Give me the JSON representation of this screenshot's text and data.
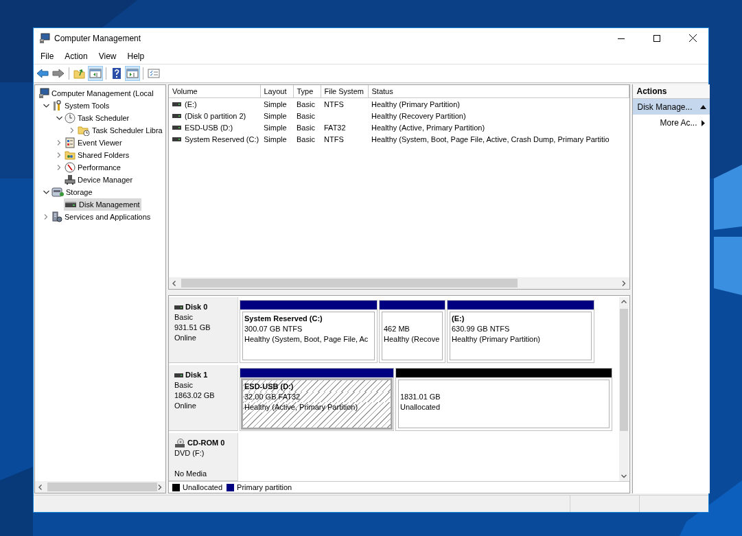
{
  "window": {
    "title": "Computer Management"
  },
  "menu": [
    "File",
    "Action",
    "View",
    "Help"
  ],
  "toolbar": [
    {
      "kind": "back",
      "pressed": false
    },
    {
      "kind": "forward",
      "pressed": false
    },
    {
      "kind": "separator"
    },
    {
      "kind": "up",
      "pressed": false
    },
    {
      "kind": "tree-pane",
      "pressed": true
    },
    {
      "kind": "separator"
    },
    {
      "kind": "help",
      "pressed": false
    },
    {
      "kind": "action-pane",
      "pressed": true
    },
    {
      "kind": "separator"
    },
    {
      "kind": "properties",
      "pressed": false
    }
  ],
  "tree": [
    {
      "label": "Computer Management (Local",
      "selected": false,
      "children": [
        {
          "label": "System Tools",
          "expanded": true,
          "selected": false,
          "children": [
            {
              "label": "Task Scheduler",
              "expanded": true,
              "selected": false,
              "children": [
                {
                  "label": "Task Scheduler Libra",
                  "expanded": false,
                  "selected": false
                }
              ]
            },
            {
              "label": "Event Viewer",
              "expanded": false,
              "selected": false
            },
            {
              "label": "Shared Folders",
              "expanded": false,
              "selected": false
            },
            {
              "label": "Performance",
              "expanded": false,
              "selected": false
            },
            {
              "label": "Device Manager",
              "selected": false
            }
          ]
        },
        {
          "label": "Storage",
          "expanded": true,
          "selected": false,
          "children": [
            {
              "label": "Disk Management",
              "selected": true
            }
          ]
        },
        {
          "label": "Services and Applications",
          "expanded": false,
          "selected": false
        }
      ]
    }
  ],
  "volumes": {
    "columns": [
      "Volume",
      "Layout",
      "Type",
      "File System",
      "Status"
    ],
    "rows": [
      [
        "(E:)",
        "Simple",
        "Basic",
        "NTFS",
        "Healthy (Primary Partition)"
      ],
      [
        "(Disk 0 partition 2)",
        "Simple",
        "Basic",
        "",
        "Healthy (Recovery Partition)"
      ],
      [
        "ESD-USB (D:)",
        "Simple",
        "Basic",
        "FAT32",
        "Healthy (Active, Primary Partition)"
      ],
      [
        "System Reserved (C:)",
        "Simple",
        "Basic",
        "NTFS",
        "Healthy (System, Boot, Page File, Active, Crash Dump, Primary Partitio"
      ]
    ]
  },
  "disks": [
    {
      "name": "Disk 0",
      "kind": "disk",
      "type": "Basic",
      "size": "931.51 GB",
      "status": "Online",
      "partitions": [
        {
          "kind": "primary",
          "selected": false,
          "name": "System Reserved  (C:)",
          "size": "300.07 GB NTFS",
          "status": "Healthy (System, Boot, Page File, Ac"
        },
        {
          "kind": "primary",
          "selected": false,
          "size": "462 MB",
          "status": "Healthy (Recove"
        },
        {
          "kind": "primary",
          "selected": false,
          "name": "(E:)",
          "size": "630.99 GB NTFS",
          "status": "Healthy (Primary Partition)"
        }
      ]
    },
    {
      "name": "Disk 1",
      "kind": "disk",
      "type": "Basic",
      "size": "1863.02 GB",
      "status": "Online",
      "partitions": [
        {
          "kind": "primary",
          "selected": true,
          "name": "ESD-USB  (D:)",
          "size": "32.00 GB FAT32",
          "status": "Healthy (Active, Primary Partition)"
        },
        {
          "kind": "unallocated",
          "selected": false,
          "size": "1831.01 GB",
          "status": "Unallocated"
        }
      ]
    },
    {
      "name": "CD-ROM 0",
      "kind": "cdrom",
      "type": "DVD (F:)",
      "status": "No Media"
    }
  ],
  "legend": [
    {
      "label": "Unallocated",
      "color": "#000000"
    },
    {
      "label": "Primary partition",
      "color": "#000080"
    }
  ],
  "actions": {
    "title": "Actions",
    "sections": [
      {
        "label": "Disk Manage...",
        "expanded": true,
        "items": [
          "More Ac..."
        ]
      }
    ]
  }
}
